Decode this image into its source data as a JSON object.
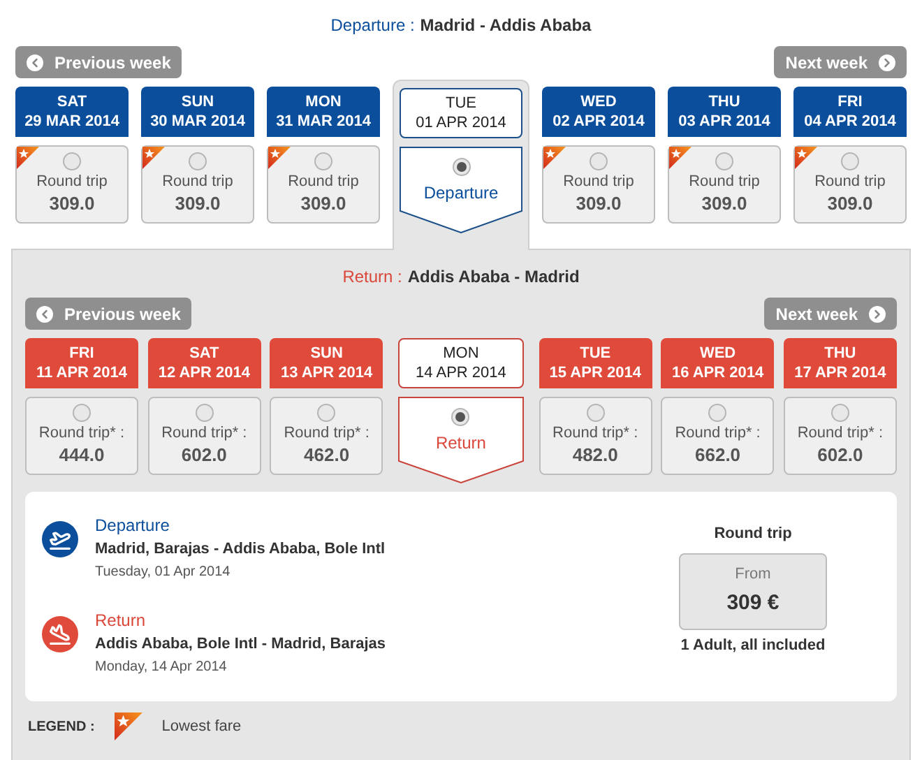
{
  "sections": [
    {
      "kind": "departure",
      "title_label": "Departure :",
      "route": "Madrid - Addis Ababa",
      "previous": "Previous week",
      "next": "Next week",
      "selected_label": "Departure",
      "days": [
        {
          "weekday": "SAT",
          "date": "29 MAR 2014",
          "fare_label": "Round trip",
          "price": "309.0",
          "lowest": true,
          "selected": false
        },
        {
          "weekday": "SUN",
          "date": "30 MAR 2014",
          "fare_label": "Round trip",
          "price": "309.0",
          "lowest": true,
          "selected": false
        },
        {
          "weekday": "MON",
          "date": "31 MAR 2014",
          "fare_label": "Round trip",
          "price": "309.0",
          "lowest": true,
          "selected": false
        },
        {
          "weekday": "TUE",
          "date": "01 APR 2014",
          "selected": true
        },
        {
          "weekday": "WED",
          "date": "02 APR 2014",
          "fare_label": "Round trip",
          "price": "309.0",
          "lowest": true,
          "selected": false
        },
        {
          "weekday": "THU",
          "date": "03 APR 2014",
          "fare_label": "Round trip",
          "price": "309.0",
          "lowest": true,
          "selected": false
        },
        {
          "weekday": "FRI",
          "date": "04 APR 2014",
          "fare_label": "Round trip",
          "price": "309.0",
          "lowest": true,
          "selected": false
        }
      ]
    },
    {
      "kind": "return",
      "title_label": "Return :",
      "route": "Addis Ababa - Madrid",
      "previous": "Previous week",
      "next": "Next week",
      "selected_label": "Return",
      "days": [
        {
          "weekday": "FRI",
          "date": "11 APR 2014",
          "fare_label": "Round trip* :",
          "price": "444.0",
          "lowest": false,
          "selected": false
        },
        {
          "weekday": "SAT",
          "date": "12 APR 2014",
          "fare_label": "Round trip* :",
          "price": "602.0",
          "lowest": false,
          "selected": false
        },
        {
          "weekday": "SUN",
          "date": "13 APR 2014",
          "fare_label": "Round trip* :",
          "price": "462.0",
          "lowest": false,
          "selected": false
        },
        {
          "weekday": "MON",
          "date": "14 APR 2014",
          "selected": true
        },
        {
          "weekday": "TUE",
          "date": "15 APR 2014",
          "fare_label": "Round trip* :",
          "price": "482.0",
          "lowest": false,
          "selected": false
        },
        {
          "weekday": "WED",
          "date": "16 APR 2014",
          "fare_label": "Round trip* :",
          "price": "662.0",
          "lowest": false,
          "selected": false
        },
        {
          "weekday": "THU",
          "date": "17 APR 2014",
          "fare_label": "Round trip* :",
          "price": "602.0",
          "lowest": false,
          "selected": false
        }
      ]
    }
  ],
  "summary": {
    "legs": [
      {
        "kind": "departure",
        "title": "Departure",
        "route": "Madrid, Barajas - Addis Ababa, Bole Intl",
        "date": "Tuesday, 01 Apr 2014"
      },
      {
        "kind": "return",
        "title": "Return",
        "route": "Addis Ababa, Bole Intl - Madrid, Barajas",
        "date": "Monday, 14 Apr 2014"
      }
    ],
    "price": {
      "heading": "Round trip",
      "from": "From",
      "amount": "309 €",
      "note": "1 Adult, all included"
    }
  },
  "legend": {
    "label": "LEGEND :",
    "text": "Lowest fare"
  }
}
